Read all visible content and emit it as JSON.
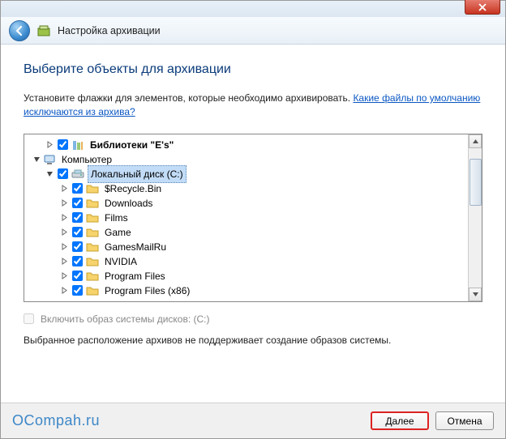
{
  "window": {
    "navbar_title": "Настройка архивации"
  },
  "content": {
    "heading": "Выберите объекты для архивации",
    "intro_text": "Установите флажки для элементов, которые необходимо архивировать. ",
    "intro_link": "Какие файлы по умолчанию исключаются из архива?"
  },
  "tree": {
    "libraries": "Библиотеки \"E's\"",
    "computer": "Компьютер",
    "local_disk": "Локальный диск (C:)",
    "items": [
      "$Recycle.Bin",
      "Downloads",
      "Films",
      "Game",
      "GamesMailRu",
      "NVIDIA",
      "Program Files",
      "Program Files (x86)"
    ]
  },
  "sysimage": {
    "label": "Включить образ системы дисков: (C:)",
    "note": "Выбранное расположение архивов не поддерживает создание образов системы."
  },
  "footer": {
    "watermark": "OCompah.ru",
    "next": "Далее",
    "cancel": "Отмена"
  }
}
